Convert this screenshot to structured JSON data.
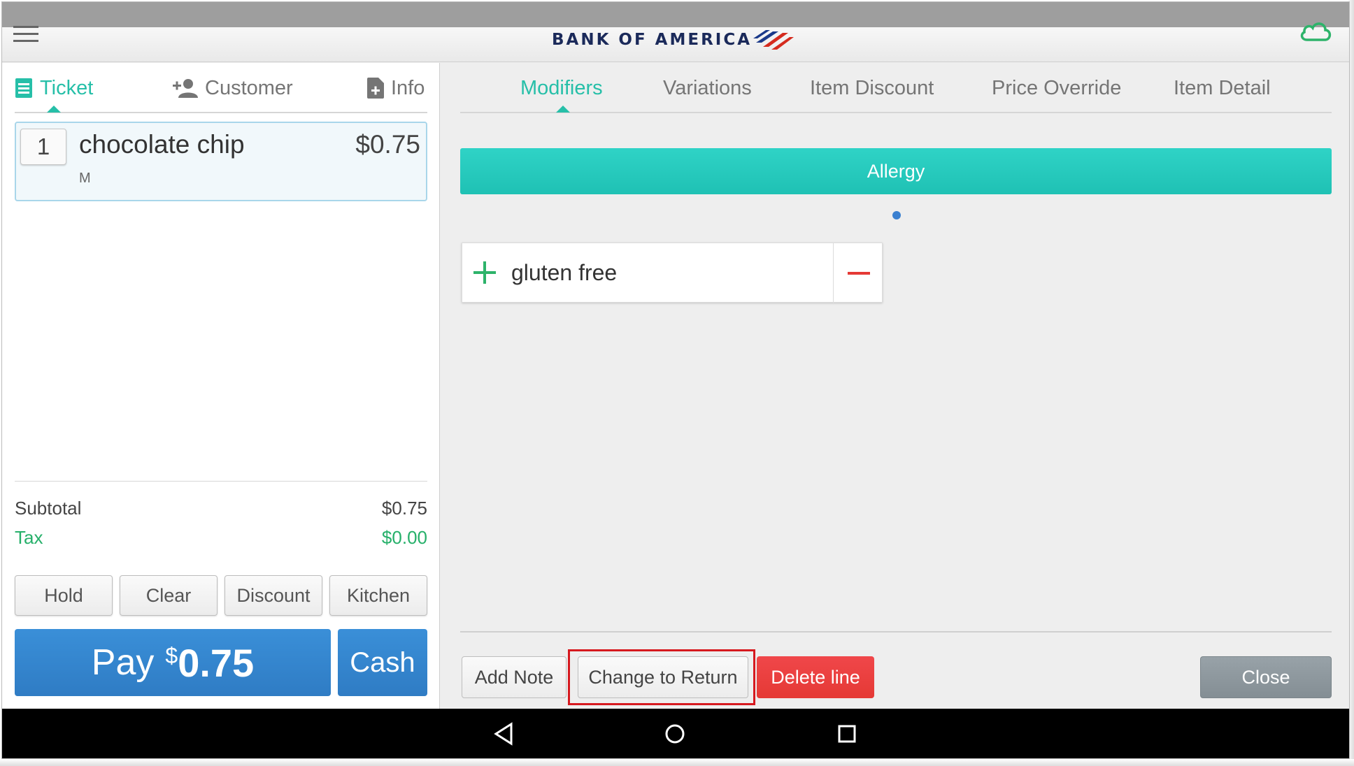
{
  "app": {
    "brand": "BANK OF AMERICA"
  },
  "colors": {
    "accent": "#26bfa8",
    "pay_blue": "#2f7cc4",
    "danger": "#e53935",
    "tax_green": "#26b06a"
  },
  "left_tabs": [
    {
      "label": "Ticket",
      "icon": "ticket-icon",
      "active": true
    },
    {
      "label": "Customer",
      "icon": "add-person-icon"
    },
    {
      "label": "Info",
      "icon": "document-plus-icon"
    }
  ],
  "ticket": {
    "lines": [
      {
        "qty": "1",
        "name": "chocolate chip",
        "price": "$0.75",
        "modifier": "M"
      }
    ],
    "subtotal_label": "Subtotal",
    "subtotal_value": "$0.75",
    "tax_label": "Tax",
    "tax_value": "$0.00"
  },
  "actions": {
    "hold": "Hold",
    "clear": "Clear",
    "discount": "Discount",
    "kitchen": "Kitchen",
    "pay_label": "Pay",
    "pay_currency": "$",
    "pay_amount": "0.75",
    "cash": "Cash"
  },
  "right_tabs": [
    {
      "label": "Modifiers",
      "active": true
    },
    {
      "label": "Variations"
    },
    {
      "label": "Item Discount"
    },
    {
      "label": "Price Override"
    },
    {
      "label": "Item Detail"
    }
  ],
  "modifier_group": "Allergy",
  "modifiers": [
    {
      "name": "gluten free"
    }
  ],
  "footer": {
    "add_note": "Add Note",
    "change_to_return": "Change to Return",
    "delete_line": "Delete line",
    "close": "Close"
  }
}
